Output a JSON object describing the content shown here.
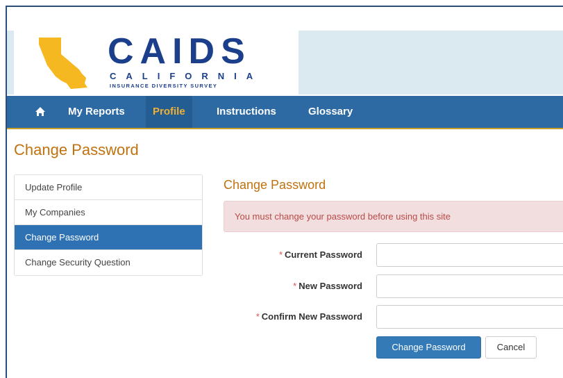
{
  "logo": {
    "title": "CAIDS",
    "subtitle": "CALIFORNIA",
    "tagline": "INSURANCE DIVERSITY SURVEY",
    "map_icon": "california-map-icon",
    "title_color": "#1c3f8c",
    "map_color": "#f5b820"
  },
  "nav": {
    "home_icon": "home-icon",
    "items": [
      {
        "label": "My Reports"
      },
      {
        "label": "Profile",
        "active": true
      },
      {
        "label": "Instructions"
      },
      {
        "label": "Glossary"
      }
    ],
    "bg_color": "#2d6aa3",
    "active_color": "#f0b133"
  },
  "page": {
    "title": "Change Password",
    "accent_color": "#c0720f"
  },
  "sidebar": {
    "items": [
      {
        "label": "Update Profile"
      },
      {
        "label": "My Companies"
      },
      {
        "label": "Change Password",
        "active": true
      },
      {
        "label": "Change Security Question"
      }
    ]
  },
  "form": {
    "section_title": "Change Password",
    "alert": "You must change your password before using this site",
    "required_marker": "*",
    "fields": [
      {
        "label": "Current Password",
        "value": ""
      },
      {
        "label": "New Password",
        "value": ""
      },
      {
        "label": "Confirm New Password",
        "value": ""
      }
    ],
    "submit_label": "Change Password",
    "cancel_label": "Cancel"
  }
}
